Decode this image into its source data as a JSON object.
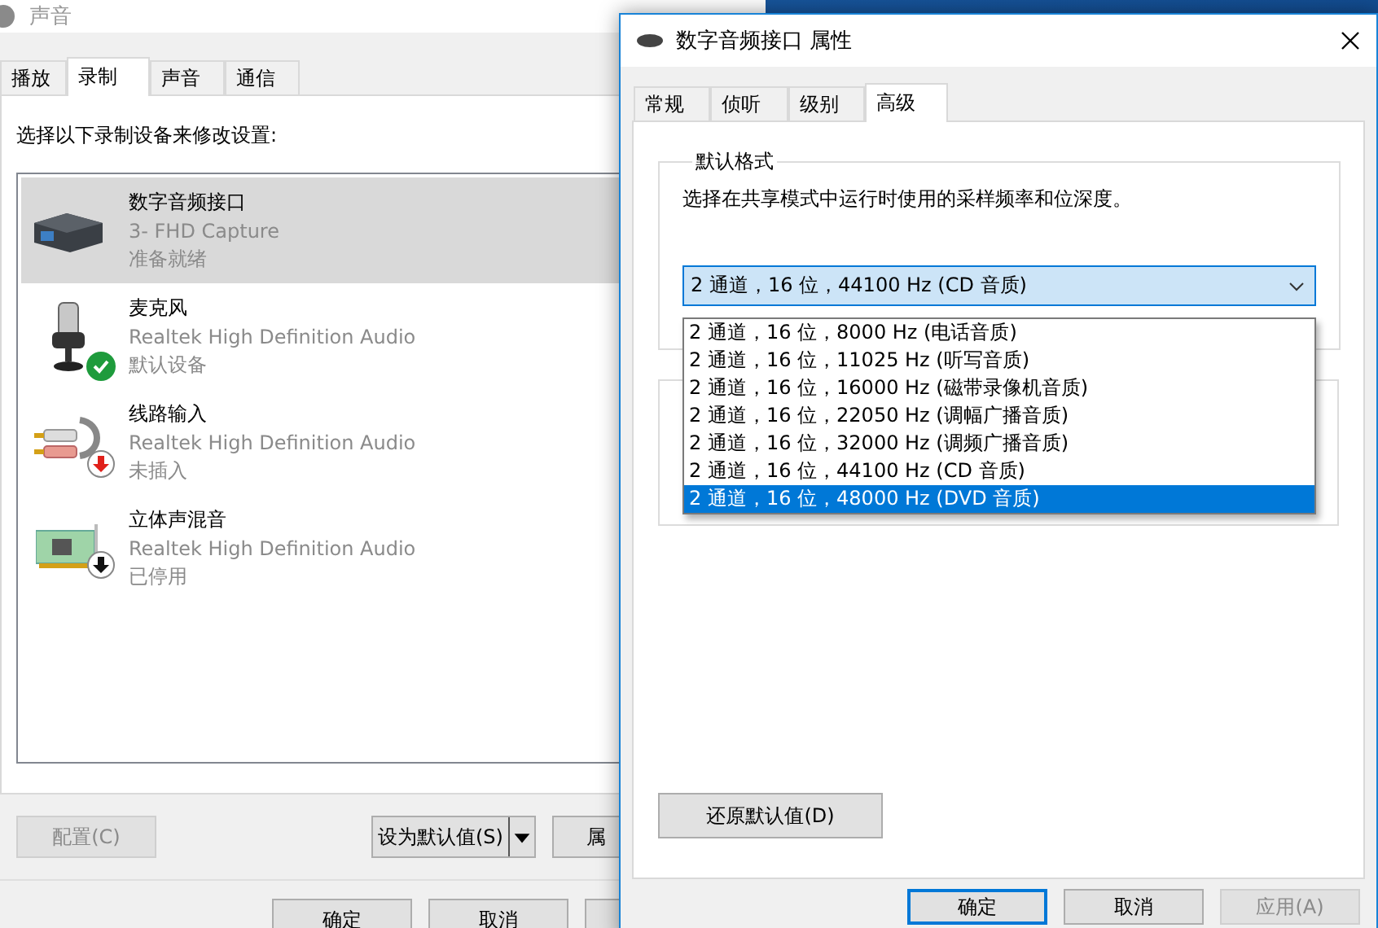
{
  "sound_window": {
    "title": "声音",
    "tabs": [
      {
        "label": "播放",
        "selected": false
      },
      {
        "label": "录制",
        "selected": true
      },
      {
        "label": "声音",
        "selected": false
      },
      {
        "label": "通信",
        "selected": false
      }
    ],
    "instruction": "选择以下录制设备来修改设置:",
    "devices": [
      {
        "name": "数字音频接口",
        "driver": "3- FHD Capture",
        "status": "准备就绪",
        "selected": true,
        "kind": "capture-box"
      },
      {
        "name": "麦克风",
        "driver": "Realtek High Definition Audio",
        "status": "默认设备",
        "selected": false,
        "kind": "microphone",
        "badge": {
          "kind": "default"
        }
      },
      {
        "name": "线路输入",
        "driver": "Realtek High Definition Audio",
        "status": "未插入",
        "selected": false,
        "kind": "line-in",
        "badge": {
          "kind": "unplugged"
        }
      },
      {
        "name": "立体声混音",
        "driver": "Realtek High Definition Audio",
        "status": "已停用",
        "selected": false,
        "kind": "sound-card",
        "badge": {
          "kind": "disabled"
        }
      }
    ],
    "buttons": [
      {
        "label": "配置(C)",
        "disabled": true,
        "kind": "plain"
      },
      {
        "label": "设为默认值(S)",
        "disabled": false,
        "kind": "split"
      },
      {
        "label": "属",
        "disabled": false,
        "kind": "plain"
      }
    ],
    "footer_buttons": [
      {
        "label": "确定",
        "disabled": false
      },
      {
        "label": "取消",
        "disabled": false
      }
    ]
  },
  "properties_window": {
    "title": "数字音频接口 属性",
    "tabs": [
      {
        "label": "常规",
        "selected": false
      },
      {
        "label": "侦听",
        "selected": false
      },
      {
        "label": "级别",
        "selected": false
      },
      {
        "label": "高级",
        "selected": true
      }
    ],
    "default_format": {
      "legend": "默认格式",
      "description": "选择在共享模式中运行时使用的采样频率和位深度。",
      "value": "2 通道，16 位，44100 Hz (CD 音质)",
      "options": [
        {
          "label": "2 通道，16 位，8000 Hz (电话音质)",
          "highlighted": false
        },
        {
          "label": "2 通道，16 位，11025 Hz (听写音质)",
          "highlighted": false
        },
        {
          "label": "2 通道，16 位，16000 Hz (磁带录像机音质)",
          "highlighted": false
        },
        {
          "label": "2 通道，16 位，22050 Hz (调幅广播音质)",
          "highlighted": false
        },
        {
          "label": "2 通道，16 位，32000 Hz (调频广播音质)",
          "highlighted": false
        },
        {
          "label": "2 通道，16 位，44100 Hz (CD 音质)",
          "highlighted": false
        },
        {
          "label": "2 通道，16 位，48000 Hz (DVD 音质)",
          "highlighted": true
        }
      ]
    },
    "restore_button": "还原默认值(D)",
    "footer_buttons": [
      {
        "label": "确定",
        "disabled": false,
        "focused": true
      },
      {
        "label": "取消",
        "disabled": false,
        "focused": false
      },
      {
        "label": "应用(A)",
        "disabled": true,
        "focused": false
      }
    ]
  }
}
